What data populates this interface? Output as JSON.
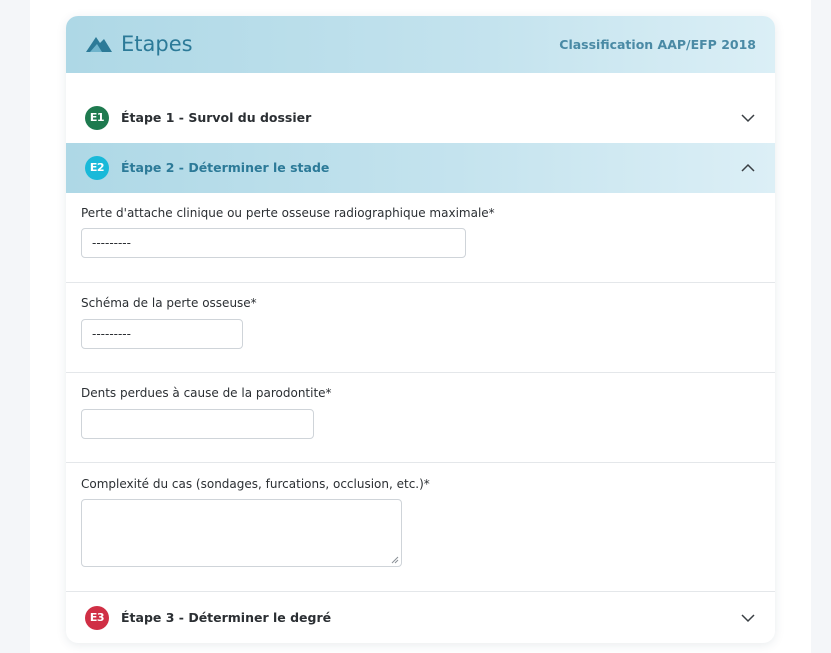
{
  "header": {
    "title": "Etapes",
    "subtitle": "Classification AAP/EFP 2018",
    "logo_icon": "mountain-logo-icon"
  },
  "steps": [
    {
      "badge": "E1",
      "label": "Étape 1 - Survol du dossier",
      "badge_color": "#1e7a4f",
      "state": "collapsed"
    },
    {
      "badge": "E2",
      "label": "Étape 2 - Déterminer le stade",
      "badge_color": "#19b9d9",
      "state": "expanded"
    },
    {
      "badge": "E3",
      "label": "Étape 3 - Déterminer le degré",
      "badge_color": "#d02f45",
      "state": "collapsed"
    }
  ],
  "form": {
    "perte_attache": {
      "label": "Perte d'attache clinique ou perte osseuse radiographique maximale*",
      "value": "---------"
    },
    "schema_perte": {
      "label": "Schéma de la perte osseuse*",
      "value": "---------"
    },
    "dents_perdues": {
      "label": "Dents perdues à cause de la parodontite*",
      "value": ""
    },
    "complexite": {
      "label": "Complexité du cas (sondages, furcations, occlusion, etc.)*",
      "value": ""
    }
  },
  "colors": {
    "accent": "#2c7a98",
    "header_bg": "#aed8e6"
  }
}
